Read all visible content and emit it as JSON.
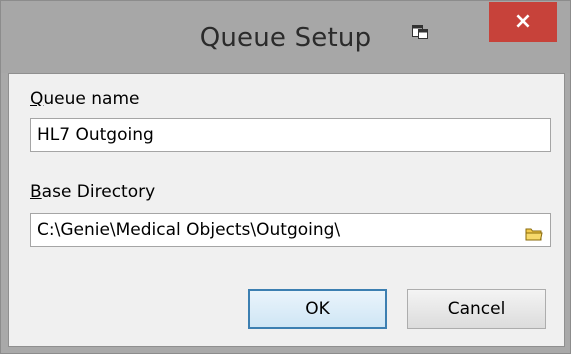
{
  "window": {
    "title": "Queue Setup",
    "close_label": "×"
  },
  "form": {
    "queue_name_label_prefix": "Q",
    "queue_name_label_rest": "ueue name",
    "queue_name_value": "HL7 Outgoing",
    "base_dir_label_prefix": "B",
    "base_dir_label_rest": "ase Directory",
    "base_dir_value": "C:\\Genie\\Medical Objects\\Outgoing\\"
  },
  "buttons": {
    "ok_label": "OK",
    "cancel_label": "Cancel"
  },
  "icons": {
    "system_menu": "window-menu-icon",
    "browse": "folder-icon",
    "close": "close-icon"
  },
  "colors": {
    "close_button": "#c7423a",
    "default_button_border": "#3c7fb1",
    "folder_icon": "#e8b51c"
  }
}
